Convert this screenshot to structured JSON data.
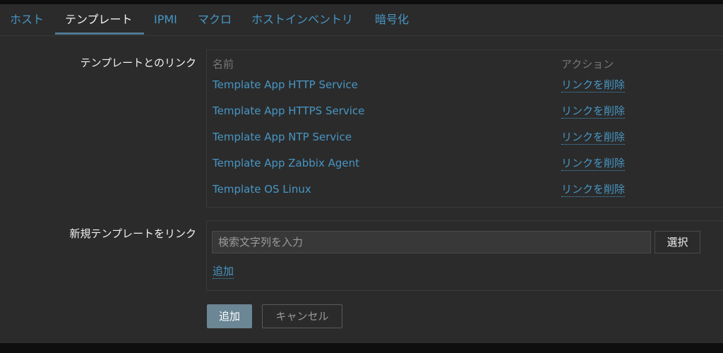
{
  "tabs": [
    {
      "label": "ホスト"
    },
    {
      "label": "テンプレート"
    },
    {
      "label": "IPMI"
    },
    {
      "label": "マクロ"
    },
    {
      "label": "ホストインベントリ"
    },
    {
      "label": "暗号化"
    }
  ],
  "active_tab": "テンプレート",
  "linked_templates": {
    "label": "テンプレートとのリンク",
    "columns": {
      "name": "名前",
      "action": "アクション"
    },
    "rows": [
      {
        "name": "Template App HTTP Service",
        "action": "リンクを削除"
      },
      {
        "name": "Template App HTTPS Service",
        "action": "リンクを削除"
      },
      {
        "name": "Template App NTP Service",
        "action": "リンクを削除"
      },
      {
        "name": "Template App Zabbix Agent",
        "action": "リンクを削除"
      },
      {
        "name": "Template OS Linux",
        "action": "リンクを削除"
      }
    ]
  },
  "new_template": {
    "label": "新規テンプレートをリンク",
    "search_placeholder": "検索文字列を入力",
    "select_label": "選択",
    "add_link_label": "追加"
  },
  "buttons": {
    "add": "追加",
    "cancel": "キャンセル"
  },
  "colors": {
    "link": "#4796c4",
    "text": "#f2f2f2",
    "background": "#2b2b2b",
    "primary_button": "#6b8694"
  }
}
